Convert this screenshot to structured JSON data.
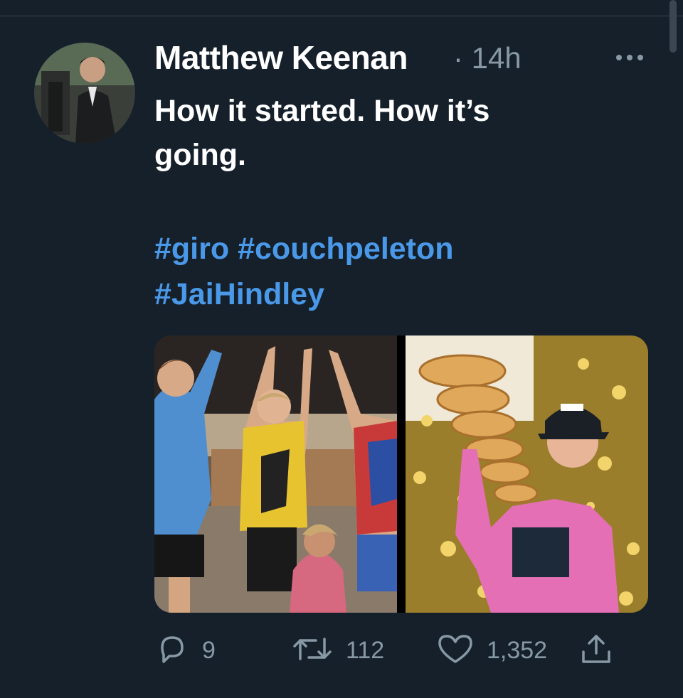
{
  "tweet": {
    "author_name": "Matthew Keenan",
    "separator": "·",
    "timestamp": "14h",
    "text_line1": "How it started. How it’s",
    "text_line2": "going.",
    "hashtags": [
      "#giro",
      "#couchpeleton",
      "#JaiHindley"
    ],
    "more_icon": "more-options-icon",
    "media": [
      {
        "description_icon": "photo-kids-podium"
      },
      {
        "description_icon": "photo-rider-trophy"
      }
    ],
    "actions": {
      "reply_count": "9",
      "retweet_count": "112",
      "like_count": "1,352"
    }
  },
  "colors": {
    "background": "#15202b",
    "text": "#ffffff",
    "secondary": "#8899a6",
    "link": "#4a99e9"
  }
}
